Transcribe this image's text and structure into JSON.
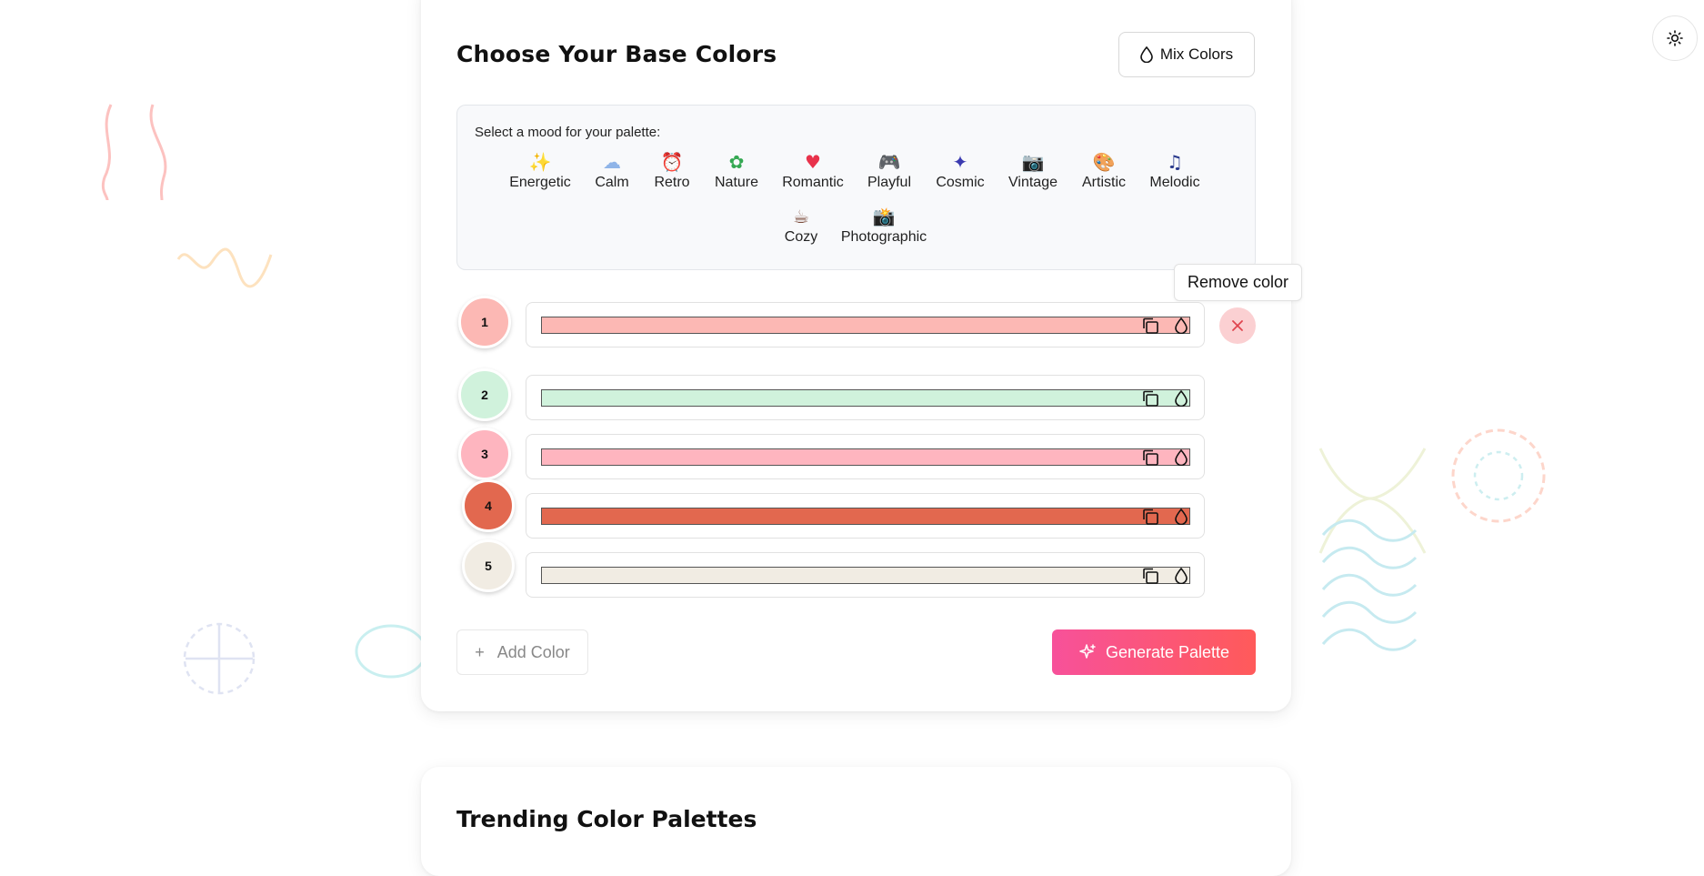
{
  "header": {
    "title": "Choose Your Base Colors",
    "mix_label": "Mix Colors",
    "theme_icon": "sun-icon"
  },
  "mood": {
    "label": "Select a mood for your palette:",
    "items": [
      {
        "label": "Energetic",
        "icon": "sparkles-icon",
        "glyph": "✨"
      },
      {
        "label": "Calm",
        "icon": "cloud-icon",
        "glyph": "☁"
      },
      {
        "label": "Retro",
        "icon": "retro-icon",
        "glyph": "⏰"
      },
      {
        "label": "Nature",
        "icon": "leaf-icon",
        "glyph": "✿"
      },
      {
        "label": "Romantic",
        "icon": "heart-icon",
        "glyph": "♥"
      },
      {
        "label": "Playful",
        "icon": "gamepad-icon",
        "glyph": "🎮"
      },
      {
        "label": "Cosmic",
        "icon": "cosmic-icon",
        "glyph": "✦"
      },
      {
        "label": "Vintage",
        "icon": "camera-icon",
        "glyph": "📷"
      },
      {
        "label": "Artistic",
        "icon": "palette-icon",
        "glyph": "🎨"
      },
      {
        "label": "Melodic",
        "icon": "music-icon",
        "glyph": "♫"
      },
      {
        "label": "Cozy",
        "icon": "mug-icon",
        "glyph": "☕"
      },
      {
        "label": "Photographic",
        "icon": "photo-icon",
        "glyph": "📸"
      }
    ]
  },
  "colors": [
    {
      "number": "1",
      "hex": "#fcb8b4"
    },
    {
      "number": "2",
      "hex": "#d0f2dc"
    },
    {
      "number": "3",
      "hex": "#feb5bf"
    },
    {
      "number": "4",
      "hex": "#e2684f"
    },
    {
      "number": "5",
      "hex": "#f1ece3"
    }
  ],
  "tooltip": "Remove color",
  "add_label": "Add Color",
  "add_symbol": "+",
  "generate_label": "Generate Palette",
  "section2_title": "Trending Color Palettes"
}
